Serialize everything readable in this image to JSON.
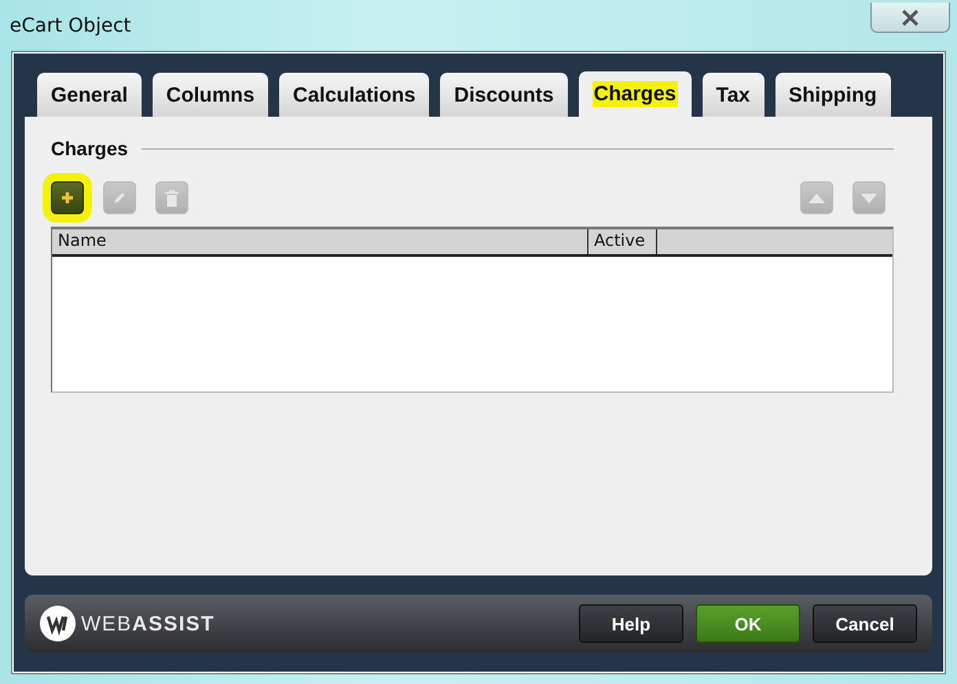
{
  "window": {
    "title": "eCart Object"
  },
  "tabs": [
    {
      "label": "General",
      "selected": false,
      "highlighted": false
    },
    {
      "label": "Columns",
      "selected": false,
      "highlighted": false
    },
    {
      "label": "Calculations",
      "selected": false,
      "highlighted": false
    },
    {
      "label": "Discounts",
      "selected": false,
      "highlighted": false
    },
    {
      "label": "Charges",
      "selected": true,
      "highlighted": true
    },
    {
      "label": "Tax",
      "selected": false,
      "highlighted": false
    },
    {
      "label": "Shipping",
      "selected": false,
      "highlighted": false
    }
  ],
  "section": {
    "title": "Charges"
  },
  "toolbar": [
    {
      "kind": "add",
      "disabled": false,
      "highlighted": true
    },
    {
      "kind": "edit",
      "disabled": true,
      "highlighted": false
    },
    {
      "kind": "delete",
      "disabled": true,
      "highlighted": false
    },
    {
      "kind": "move-up",
      "disabled": true,
      "highlighted": false
    },
    {
      "kind": "move-down",
      "disabled": true,
      "highlighted": false
    }
  ],
  "table": {
    "columns": [
      "Name",
      "Active"
    ]
  },
  "footer": {
    "logo": "WEB**ASSIST**",
    "buttons": [
      {
        "label": "Help",
        "kind": "normal"
      },
      {
        "label": "OK",
        "kind": "primary"
      },
      {
        "label": "Cancel",
        "kind": "normal"
      }
    ]
  }
}
